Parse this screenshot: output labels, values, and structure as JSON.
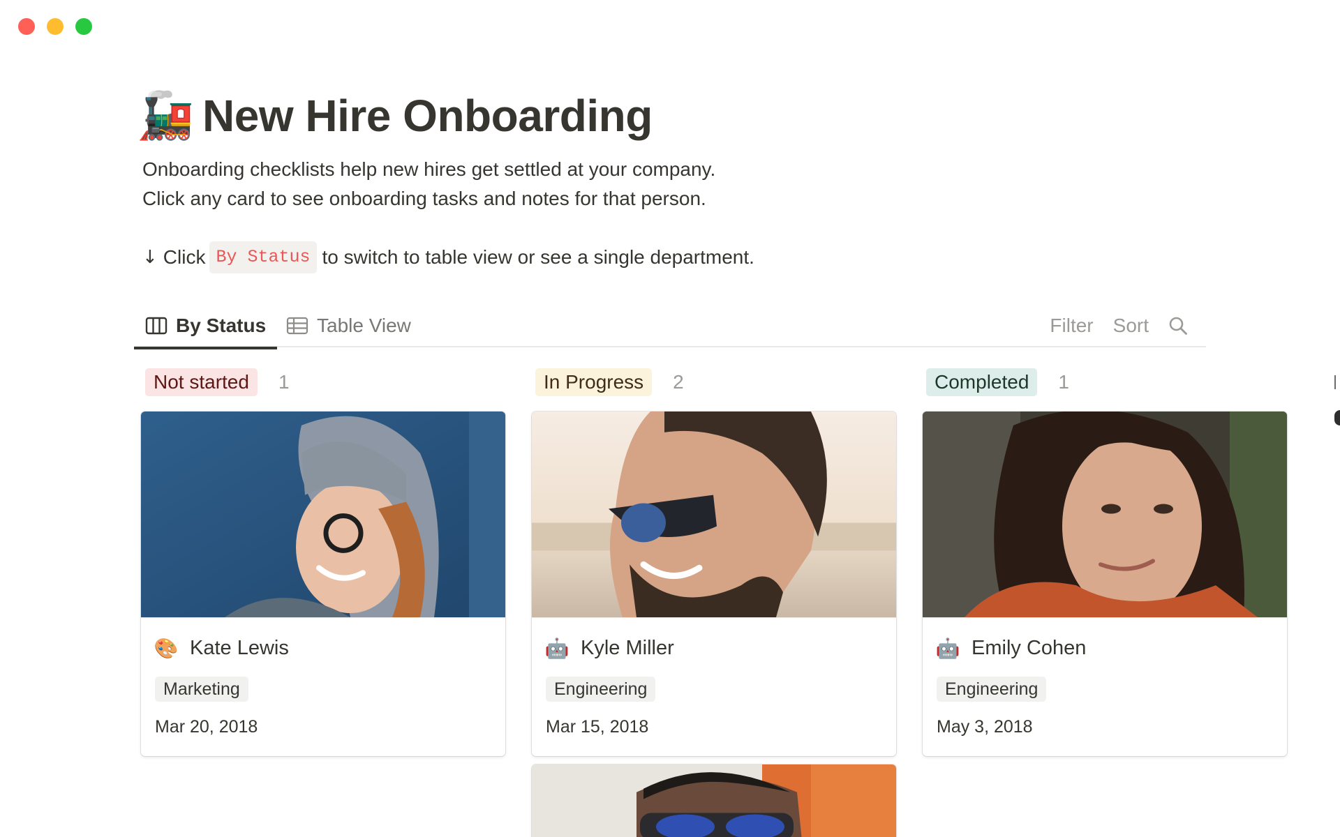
{
  "page": {
    "emoji": "🚂",
    "title": "New Hire Onboarding",
    "description_line1": "Onboarding checklists help new hires get settled at your company.",
    "description_line2": "Click any card to see onboarding tasks and notes for that person.",
    "hint_arrow": "↓",
    "hint_prefix": "Click",
    "hint_code": "By Status",
    "hint_suffix": "to switch to table view or see a single department."
  },
  "tabs": [
    {
      "label": "By Status",
      "icon": "board-icon",
      "active": true
    },
    {
      "label": "Table View",
      "icon": "table-icon",
      "active": false
    }
  ],
  "tools": {
    "filter": "Filter",
    "sort": "Sort",
    "search_icon": "search-icon"
  },
  "columns": [
    {
      "status": "Not started",
      "count": "1",
      "color": "#fbe4e4"
    },
    {
      "status": "In Progress",
      "count": "2",
      "color": "#fbf3db"
    },
    {
      "status": "Completed",
      "count": "1",
      "color": "#ddedea"
    }
  ],
  "cards": [
    {
      "name": "Kate Lewis",
      "emoji": "🎨",
      "department": "Marketing",
      "date": "Mar 20, 2018"
    },
    {
      "name": "Kyle Miller",
      "emoji": "🤖",
      "department": "Engineering",
      "date": "Mar 15, 2018"
    },
    {
      "name": "Emily Cohen",
      "emoji": "🤖",
      "department": "Engineering",
      "date": "May 3, 2018"
    }
  ]
}
